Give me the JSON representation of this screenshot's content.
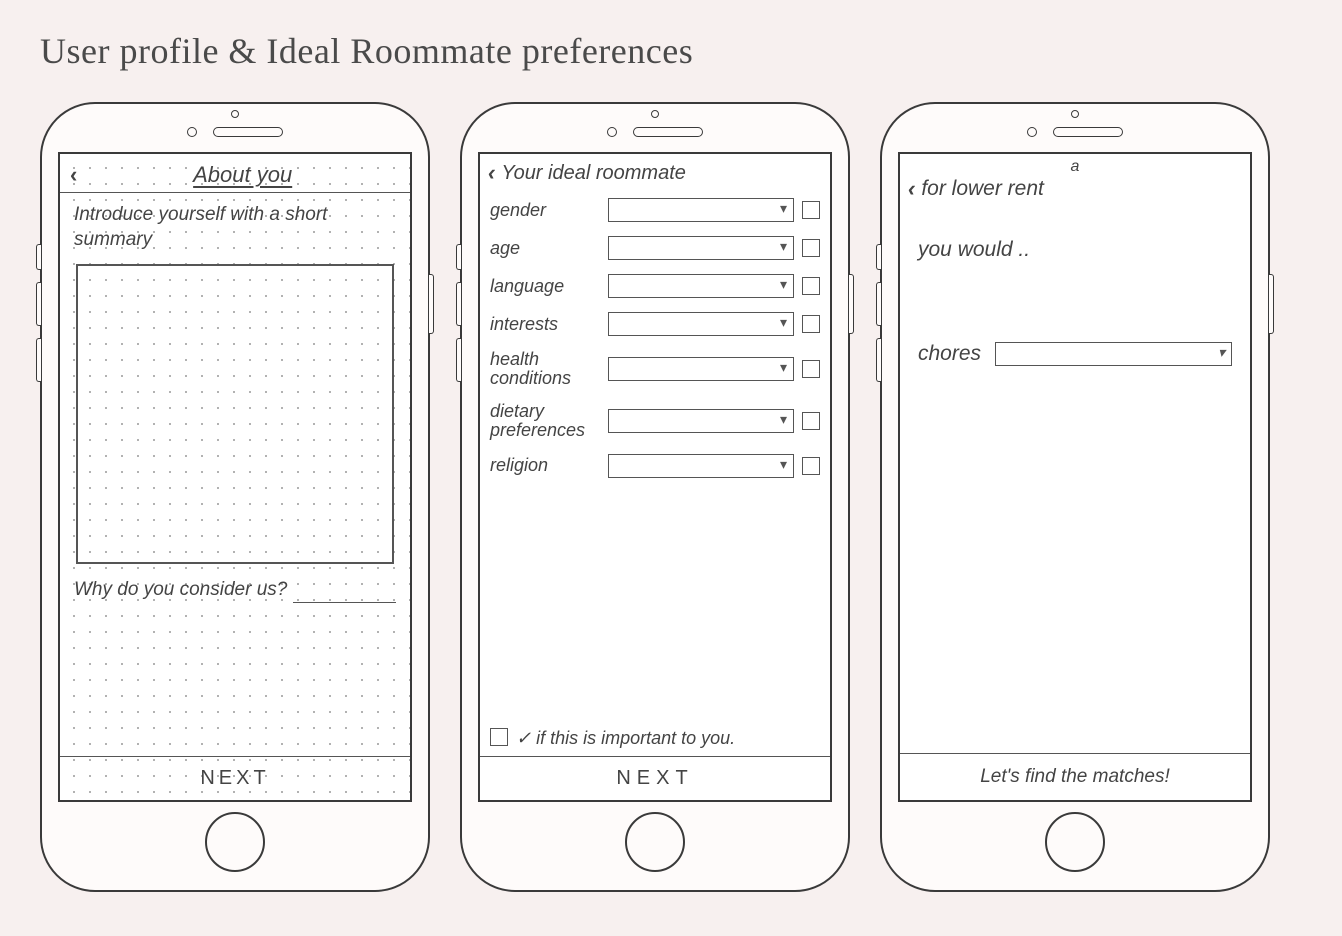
{
  "page_title": "User profile & Ideal Roommate preferences",
  "screen1": {
    "header_title": "About you",
    "intro_prompt": "Introduce yourself with a short summary",
    "question": "Why do you consider us?",
    "next_label": "NEXT"
  },
  "screen2": {
    "header_title": "Your ideal roommate",
    "prefs": [
      {
        "label": "gender"
      },
      {
        "label": "age"
      },
      {
        "label": "language"
      },
      {
        "label": "interests"
      },
      {
        "label": "health conditions"
      },
      {
        "label": "dietary preferences"
      },
      {
        "label": "religion"
      }
    ],
    "hint": "✓ if this is important to you.",
    "next_label": "NEXT"
  },
  "screen3": {
    "super_a": "a",
    "header_title": "for lower rent",
    "you_would": "you would ..",
    "chores_label": "chores",
    "cta": "Let's find the matches!"
  }
}
